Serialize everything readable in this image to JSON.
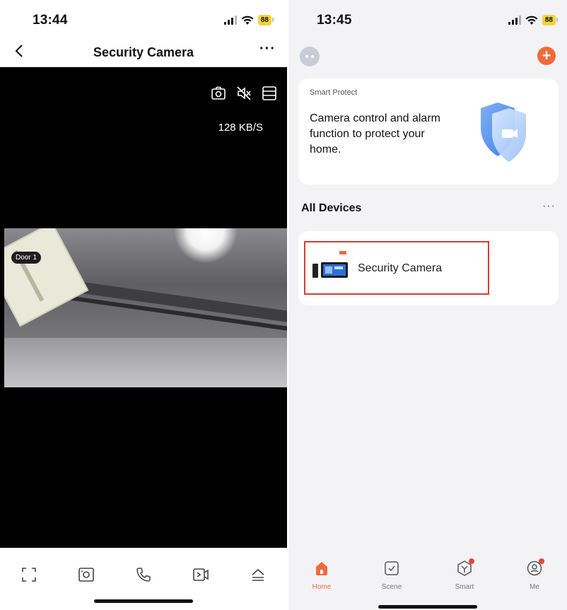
{
  "left": {
    "status": {
      "time": "13:44",
      "battery": "88"
    },
    "nav": {
      "title": "Security Camera",
      "more": "···"
    },
    "video": {
      "rate": "128 KB/S",
      "camera_label": "Door 1"
    }
  },
  "right": {
    "status": {
      "time": "13:45",
      "battery": "88"
    },
    "add_button": "+",
    "smart_protect": {
      "kicker": "Smart Protect",
      "description": "Camera control and alarm function to protect your home."
    },
    "devices": {
      "title": "All Devices",
      "more": "···",
      "items": [
        {
          "name": "Security Camera"
        }
      ]
    },
    "tabs": [
      {
        "label": "Home",
        "icon": "home-icon",
        "active": true
      },
      {
        "label": "Scene",
        "icon": "scene-icon"
      },
      {
        "label": "Smart",
        "icon": "smart-icon",
        "badge": true
      },
      {
        "label": "Me",
        "icon": "me-icon",
        "badge": true
      }
    ]
  },
  "colors": {
    "accent": "#f26a3b",
    "highlight_border": "#e0382e",
    "battery": "#f4d23c",
    "badge": "#e8453a"
  }
}
